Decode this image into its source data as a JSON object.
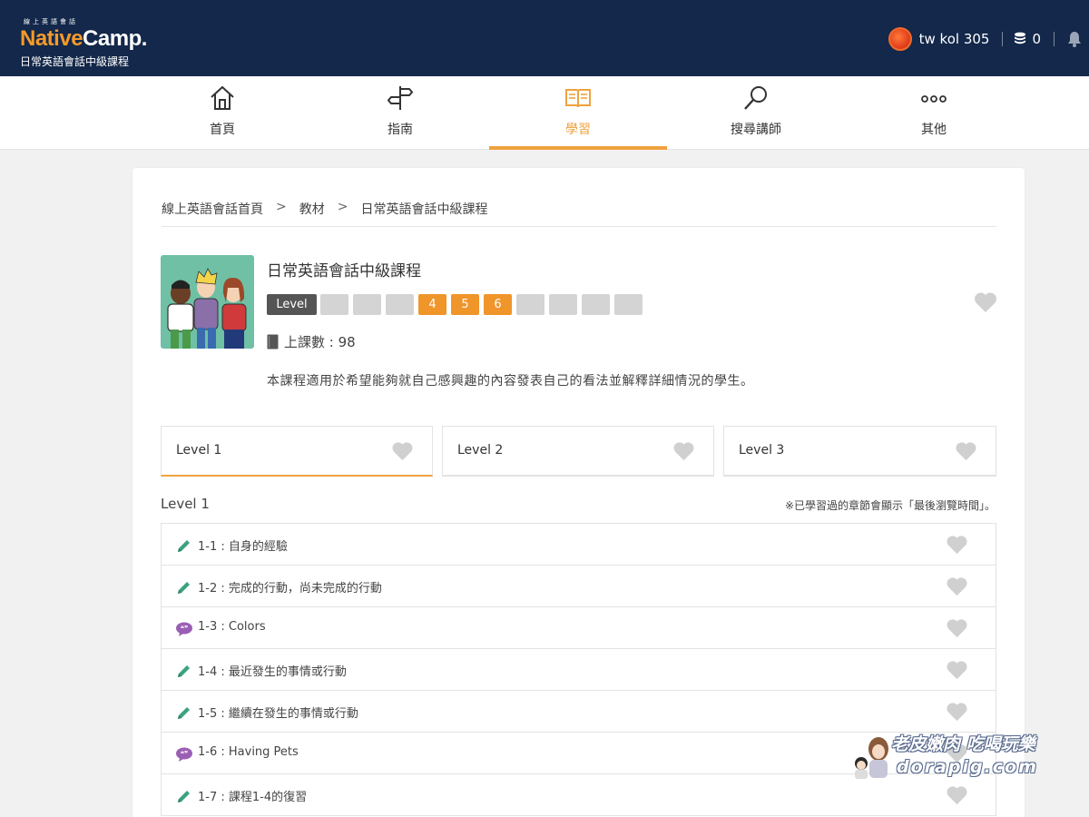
{
  "header": {
    "brand_small": "線上英語會話",
    "brand_native": "Native",
    "brand_camp": "Camp.",
    "subtitle": "日常英語會話中級課程",
    "user_name": "tw kol 305",
    "coin_count": "0"
  },
  "nav": {
    "items": [
      {
        "label": "首頁",
        "icon": "home-icon"
      },
      {
        "label": "指南",
        "icon": "signpost-icon"
      },
      {
        "label": "學習",
        "icon": "book-open-icon",
        "active": true
      },
      {
        "label": "搜尋講師",
        "icon": "search-icon"
      },
      {
        "label": "其他",
        "icon": "more-icon"
      }
    ]
  },
  "breadcrumb": [
    "線上英語會話首頁",
    ">",
    "教材",
    ">",
    "日常英語會話中級課程"
  ],
  "course": {
    "title": "日常英語會話中級課程",
    "level_tag": "Level",
    "levels": [
      "",
      "",
      "",
      "4",
      "5",
      "6",
      "",
      "",
      "",
      ""
    ],
    "lessons_label": "上課數 : 98",
    "description": "本課程適用於希望能夠就自己感興趣的內容發表自己的看法並解釋詳細情況的學生。"
  },
  "tabs": [
    {
      "label": "Level 1",
      "active": true
    },
    {
      "label": "Level 2"
    },
    {
      "label": "Level 3"
    }
  ],
  "section": {
    "title": "Level 1",
    "note": "※已學習過的章節會顯示「最後瀏覽時間」。"
  },
  "chapters": [
    {
      "label": "1-1 : 自身的經驗",
      "icon": "pencil-icon"
    },
    {
      "label": "1-2 : 完成的行動，尚未完成的行動",
      "icon": "pencil-icon"
    },
    {
      "label": "1-3 : Colors",
      "icon": "speech-bubble-icon"
    },
    {
      "label": "1-4 : 最近發生的事情或行動",
      "icon": "pencil-icon"
    },
    {
      "label": "1-5 : 繼續在發生的事情或行動",
      "icon": "pencil-icon"
    },
    {
      "label": "1-6 : Having Pets",
      "icon": "speech-bubble-icon"
    },
    {
      "label": "1-7 : 課程1-4的復習",
      "icon": "pencil-icon"
    }
  ],
  "watermark": {
    "line1": "老皮嫩肉 吃喝玩樂",
    "line2": "dorapig.com"
  },
  "colors": {
    "header_bg": "#13284a",
    "accent": "#f0a23e",
    "level_on": "#f0952a",
    "heart": "#d0d0d0",
    "pencil": "#3aa37d",
    "bubble": "#9a5fb5"
  }
}
